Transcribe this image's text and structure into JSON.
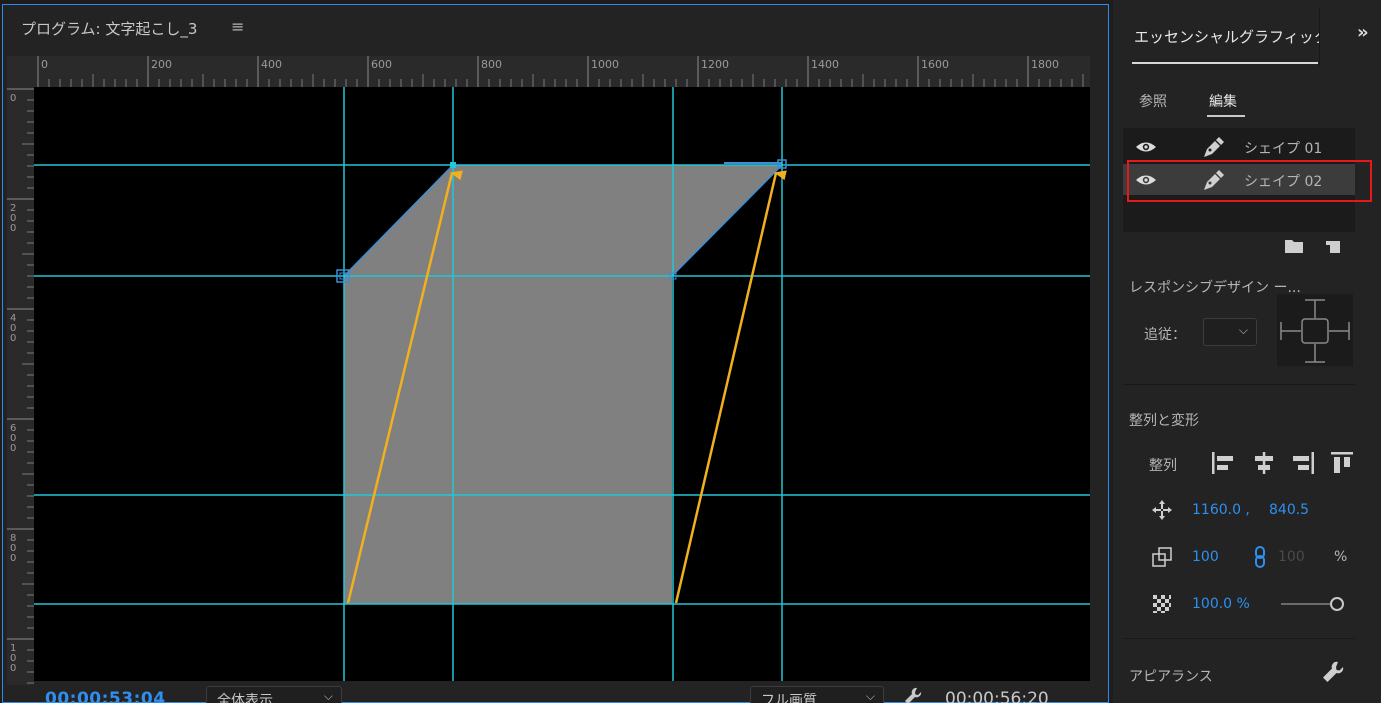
{
  "program_monitor": {
    "title": "プログラム: 文字起こし_3",
    "menu_icon": "hamburger-menu-icon",
    "ruler": {
      "h_labels": [
        "0",
        "200",
        "400",
        "600",
        "800",
        "1000",
        "1200",
        "1400",
        "1600",
        "1800"
      ],
      "v_labels": [
        "0",
        "2\n0\n0",
        "4\n0\n0",
        "6\n0\n0",
        "8\n0\n0",
        "1\n0\n0"
      ]
    },
    "canvas": {
      "guide_color": "#22c6d6",
      "shape_fill": "#808080",
      "arrow_color": "#f2b01e"
    },
    "timecode_current": "00:00:53:04",
    "zoom_label": "全体表示",
    "quality_label": "フル画質",
    "timecode_duration": "00:00:56:20"
  },
  "essential_graphics": {
    "title": "エッセンシャルグラフィックス",
    "more_icon": "double-chevron-right-icon",
    "tabs": [
      {
        "label": "参照",
        "active": false
      },
      {
        "label": "編集",
        "active": true
      }
    ],
    "layers": [
      {
        "name": "シェイプ 01",
        "selected": false
      },
      {
        "name": "シェイプ 02",
        "selected": true
      }
    ],
    "responsive_label": "レスポンシブデザイン ー...",
    "follow_label": "追従：",
    "align_section": "整列と変形",
    "align_label": "整列",
    "position_x": "1160.0 ,",
    "position_y": "840.5",
    "scale": "100",
    "scale_linked": "100",
    "scale_unit": "%",
    "opacity": "100.0 %",
    "appearance_section": "アピアランス",
    "accent_color": "#2f8ff0",
    "highlight_color": "#e5181a"
  }
}
